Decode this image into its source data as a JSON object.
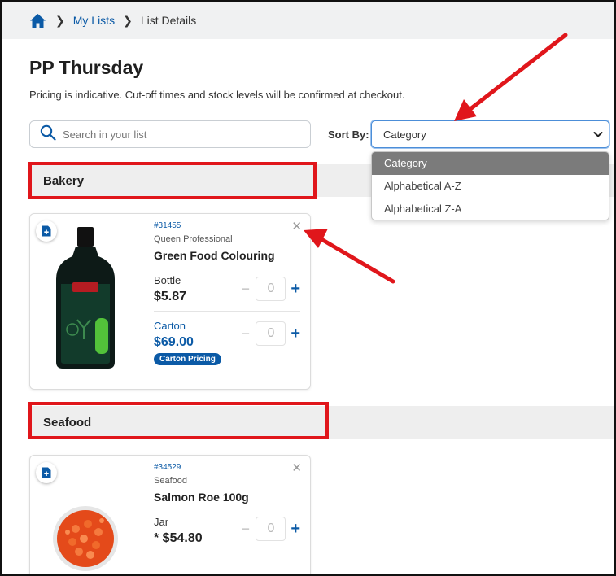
{
  "breadcrumb": {
    "home_icon": "home-icon",
    "link": "My Lists",
    "current": "List Details"
  },
  "page": {
    "title": "PP Thursday",
    "notice": "Pricing is indicative. Cut-off times and stock levels will be confirmed at checkout."
  },
  "search": {
    "placeholder": "Search in your list",
    "value": ""
  },
  "sort": {
    "label": "Sort By:",
    "selected": "Category",
    "options": [
      "Category",
      "Alphabetical A-Z",
      "Alphabetical Z-A"
    ]
  },
  "categories": [
    {
      "name": "Bakery",
      "products": [
        {
          "sku": "#31455",
          "brand": "Queen Professional",
          "name": "Green Food Colouring",
          "units": [
            {
              "label": "Bottle",
              "price": "$5.87",
              "qty": "0"
            },
            {
              "label": "Carton",
              "price": "$69.00",
              "qty": "0",
              "badge": "Carton Pricing"
            }
          ]
        }
      ]
    },
    {
      "name": "Seafood",
      "products": [
        {
          "sku": "#34529",
          "brand": "Seafood",
          "name": "Salmon Roe 100g",
          "units": [
            {
              "label": "Jar",
              "price": "* $54.80",
              "qty": "0"
            }
          ]
        }
      ]
    }
  ],
  "icons": {
    "search": "search-icon",
    "close": "close-icon",
    "add_to_list": "add-to-list-icon",
    "caret": "chevron-down-icon"
  },
  "colors": {
    "accent": "#0b5aa6",
    "annotation": "#e0161b",
    "selected_option": "#7b7b7b"
  }
}
